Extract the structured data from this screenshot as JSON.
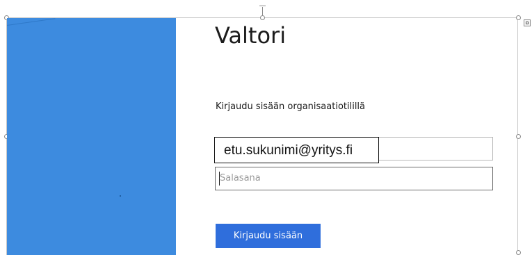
{
  "brand": {
    "title": "Valtori"
  },
  "login": {
    "subtitle": "Kirjaudu sisään organisaatiotilillä",
    "username_value": "etu.sukunimi@yritys.fi",
    "password_placeholder": "Salasana",
    "sign_in_label": "Kirjaudu sisään"
  },
  "colors": {
    "panel_blue": "#3d8bdf",
    "button_blue": "#2f6edc"
  },
  "icons": [
    "resize-handle-icon",
    "rotate-handle-icon",
    "layout-options-icon"
  ]
}
